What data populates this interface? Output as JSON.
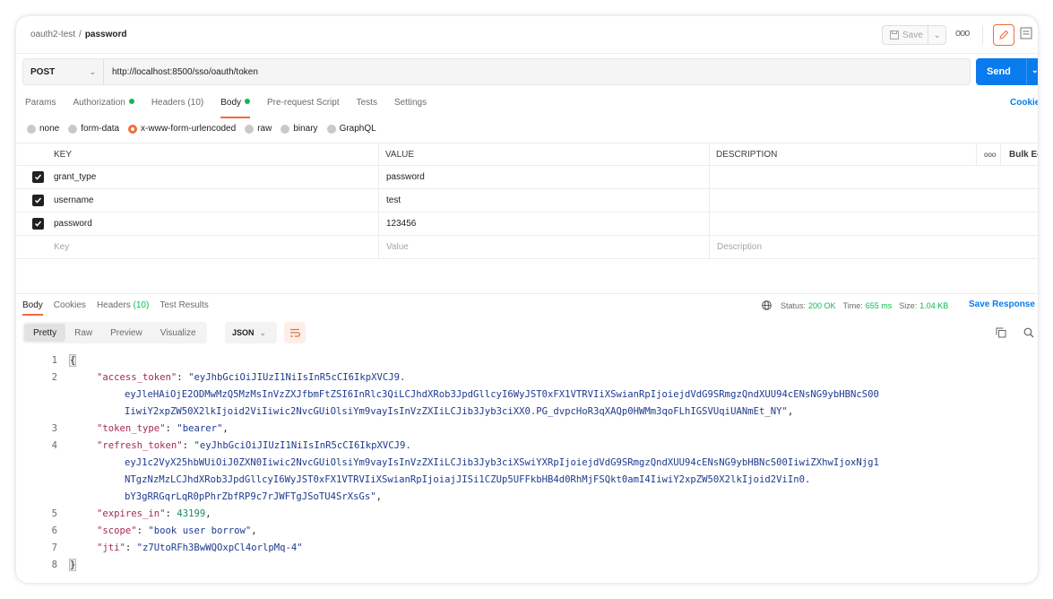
{
  "header": {
    "breadcrumb_collection": "oauth2-test",
    "breadcrumb_separator": "/",
    "breadcrumb_request": "password",
    "save_label": "Save",
    "more_label": "ooo"
  },
  "request": {
    "method": "POST",
    "url": "http://localhost:8500/sso/oauth/token",
    "send_label": "Send"
  },
  "req_tabs": {
    "params": "Params",
    "authorization": "Authorization",
    "headers": "Headers",
    "headers_count": "(10)",
    "body": "Body",
    "prerequest": "Pre-request Script",
    "tests": "Tests",
    "settings": "Settings",
    "cookies": "Cookies"
  },
  "body_types": {
    "none": "none",
    "form_data": "form-data",
    "urlencoded": "x-www-form-urlencoded",
    "raw": "raw",
    "binary": "binary",
    "graphql": "GraphQL",
    "selected": "x-www-form-urlencoded"
  },
  "params_table": {
    "headers": {
      "key": "KEY",
      "value": "VALUE",
      "description": "DESCRIPTION",
      "more": "ooo",
      "bulk_edit": "Bulk Edit"
    },
    "rows": [
      {
        "key": "grant_type",
        "value": "password",
        "description": "",
        "checked": true
      },
      {
        "key": "username",
        "value": "test",
        "description": "",
        "checked": true
      },
      {
        "key": "password",
        "value": "123456",
        "description": "",
        "checked": true
      }
    ],
    "placeholders": {
      "key": "Key",
      "value": "Value",
      "description": "Description"
    }
  },
  "response": {
    "tabs": {
      "body": "Body",
      "cookies": "Cookies",
      "headers": "Headers",
      "headers_count": "(10)",
      "test_results": "Test Results"
    },
    "status_label": "Status:",
    "status_value": "200 OK",
    "time_label": "Time:",
    "time_value": "655 ms",
    "size_label": "Size:",
    "size_value": "1.04 KB",
    "save_response": "Save Response",
    "view_tabs": {
      "pretty": "Pretty",
      "raw": "Raw",
      "preview": "Preview",
      "visualize": "Visualize"
    },
    "format": "JSON"
  },
  "json_body": {
    "open_brace": "{",
    "close_brace": "}",
    "access_token_key": "\"access_token\"",
    "access_token_1": "\"eyJhbGciOiJIUzI1NiIsInR5cCI6IkpXVCJ9.",
    "access_token_2": "eyJleHAiOjE2ODMwMzQ5MzMsInVzZXJfbmFtZSI6InRlc3QiLCJhdXRob3JpdGllcyI6WyJST0xFX1VTRVIiXSwianRpIjoiejdVdG9SRmgzQndXUU94cENsNG9ybHBNcS00",
    "access_token_3": "IiwiY2xpZW50X2lkIjoid2ViIiwic2NvcGUiOlsiYm9vayIsInVzZXIiLCJib3Jyb3ciXX0.PG_dvpcHoR3qXAQp0HWMm3qoFLhIGSVUqiUANmEt_NY\"",
    "token_type_key": "\"token_type\"",
    "token_type_value": "\"bearer\"",
    "refresh_token_key": "\"refresh_token\"",
    "refresh_token_1": "\"eyJhbGciOiJIUzI1NiIsInR5cCI6IkpXVCJ9.",
    "refresh_token_2": "eyJ1c2VyX25hbWUiOiJ0ZXN0Iiwic2NvcGUiOlsiYm9vayIsInVzZXIiLCJib3Jyb3ciXSwiYXRpIjoiejdVdG9SRmgzQndXUU94cENsNG9ybHBNcS00IiwiZXhwIjoxNjg1",
    "refresh_token_3": "NTgzNzMzLCJhdXRob3JpdGllcyI6WyJST0xFX1VTRVIiXSwianRpIjoiajJISi1CZUp5UFFkbHB4d0RhMjFSQkt0amI4IiwiY2xpZW50X2lkIjoid2ViIn0.",
    "refresh_token_4": "bY3gRRGqrLqR0pPhrZbfRP9c7rJWFTgJSoTU4SrXsGs\"",
    "expires_in_key": "\"expires_in\"",
    "expires_in_value": "43199",
    "scope_key": "\"scope\"",
    "scope_value": "\"book user borrow\"",
    "jti_key": "\"jti\"",
    "jti_value": "\"z7UtoRFh3BwWQOxpCl4orlpMq-4\"",
    "line_numbers": [
      "1",
      "2",
      "3",
      "4",
      "5",
      "6",
      "7",
      "8"
    ]
  }
}
